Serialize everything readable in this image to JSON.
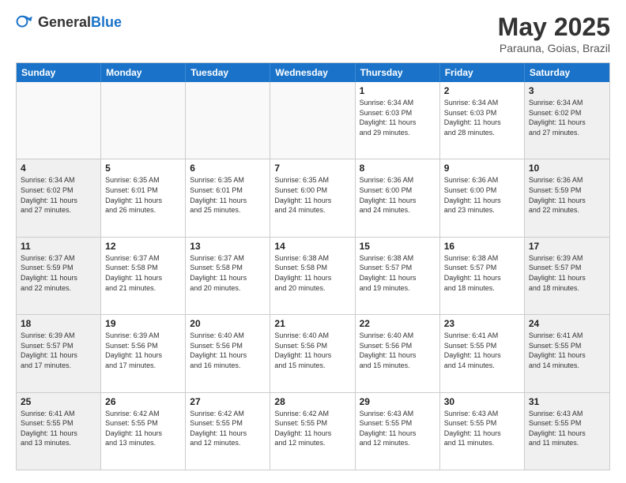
{
  "header": {
    "logo_general": "General",
    "logo_blue": "Blue",
    "month_year": "May 2025",
    "location": "Parauna, Goias, Brazil"
  },
  "day_headers": [
    "Sunday",
    "Monday",
    "Tuesday",
    "Wednesday",
    "Thursday",
    "Friday",
    "Saturday"
  ],
  "rows": [
    {
      "cells": [
        {
          "day": "",
          "info": "",
          "empty": true
        },
        {
          "day": "",
          "info": "",
          "empty": true
        },
        {
          "day": "",
          "info": "",
          "empty": true
        },
        {
          "day": "",
          "info": "",
          "empty": true
        },
        {
          "day": "1",
          "info": "Sunrise: 6:34 AM\nSunset: 6:03 PM\nDaylight: 11 hours\nand 29 minutes.",
          "empty": false
        },
        {
          "day": "2",
          "info": "Sunrise: 6:34 AM\nSunset: 6:03 PM\nDaylight: 11 hours\nand 28 minutes.",
          "empty": false
        },
        {
          "day": "3",
          "info": "Sunrise: 6:34 AM\nSunset: 6:02 PM\nDaylight: 11 hours\nand 27 minutes.",
          "empty": false
        }
      ]
    },
    {
      "cells": [
        {
          "day": "4",
          "info": "Sunrise: 6:34 AM\nSunset: 6:02 PM\nDaylight: 11 hours\nand 27 minutes.",
          "empty": false
        },
        {
          "day": "5",
          "info": "Sunrise: 6:35 AM\nSunset: 6:01 PM\nDaylight: 11 hours\nand 26 minutes.",
          "empty": false
        },
        {
          "day": "6",
          "info": "Sunrise: 6:35 AM\nSunset: 6:01 PM\nDaylight: 11 hours\nand 25 minutes.",
          "empty": false
        },
        {
          "day": "7",
          "info": "Sunrise: 6:35 AM\nSunset: 6:00 PM\nDaylight: 11 hours\nand 24 minutes.",
          "empty": false
        },
        {
          "day": "8",
          "info": "Sunrise: 6:36 AM\nSunset: 6:00 PM\nDaylight: 11 hours\nand 24 minutes.",
          "empty": false
        },
        {
          "day": "9",
          "info": "Sunrise: 6:36 AM\nSunset: 6:00 PM\nDaylight: 11 hours\nand 23 minutes.",
          "empty": false
        },
        {
          "day": "10",
          "info": "Sunrise: 6:36 AM\nSunset: 5:59 PM\nDaylight: 11 hours\nand 22 minutes.",
          "empty": false
        }
      ]
    },
    {
      "cells": [
        {
          "day": "11",
          "info": "Sunrise: 6:37 AM\nSunset: 5:59 PM\nDaylight: 11 hours\nand 22 minutes.",
          "empty": false
        },
        {
          "day": "12",
          "info": "Sunrise: 6:37 AM\nSunset: 5:58 PM\nDaylight: 11 hours\nand 21 minutes.",
          "empty": false
        },
        {
          "day": "13",
          "info": "Sunrise: 6:37 AM\nSunset: 5:58 PM\nDaylight: 11 hours\nand 20 minutes.",
          "empty": false
        },
        {
          "day": "14",
          "info": "Sunrise: 6:38 AM\nSunset: 5:58 PM\nDaylight: 11 hours\nand 20 minutes.",
          "empty": false
        },
        {
          "day": "15",
          "info": "Sunrise: 6:38 AM\nSunset: 5:57 PM\nDaylight: 11 hours\nand 19 minutes.",
          "empty": false
        },
        {
          "day": "16",
          "info": "Sunrise: 6:38 AM\nSunset: 5:57 PM\nDaylight: 11 hours\nand 18 minutes.",
          "empty": false
        },
        {
          "day": "17",
          "info": "Sunrise: 6:39 AM\nSunset: 5:57 PM\nDaylight: 11 hours\nand 18 minutes.",
          "empty": false
        }
      ]
    },
    {
      "cells": [
        {
          "day": "18",
          "info": "Sunrise: 6:39 AM\nSunset: 5:57 PM\nDaylight: 11 hours\nand 17 minutes.",
          "empty": false
        },
        {
          "day": "19",
          "info": "Sunrise: 6:39 AM\nSunset: 5:56 PM\nDaylight: 11 hours\nand 17 minutes.",
          "empty": false
        },
        {
          "day": "20",
          "info": "Sunrise: 6:40 AM\nSunset: 5:56 PM\nDaylight: 11 hours\nand 16 minutes.",
          "empty": false
        },
        {
          "day": "21",
          "info": "Sunrise: 6:40 AM\nSunset: 5:56 PM\nDaylight: 11 hours\nand 15 minutes.",
          "empty": false
        },
        {
          "day": "22",
          "info": "Sunrise: 6:40 AM\nSunset: 5:56 PM\nDaylight: 11 hours\nand 15 minutes.",
          "empty": false
        },
        {
          "day": "23",
          "info": "Sunrise: 6:41 AM\nSunset: 5:55 PM\nDaylight: 11 hours\nand 14 minutes.",
          "empty": false
        },
        {
          "day": "24",
          "info": "Sunrise: 6:41 AM\nSunset: 5:55 PM\nDaylight: 11 hours\nand 14 minutes.",
          "empty": false
        }
      ]
    },
    {
      "cells": [
        {
          "day": "25",
          "info": "Sunrise: 6:41 AM\nSunset: 5:55 PM\nDaylight: 11 hours\nand 13 minutes.",
          "empty": false
        },
        {
          "day": "26",
          "info": "Sunrise: 6:42 AM\nSunset: 5:55 PM\nDaylight: 11 hours\nand 13 minutes.",
          "empty": false
        },
        {
          "day": "27",
          "info": "Sunrise: 6:42 AM\nSunset: 5:55 PM\nDaylight: 11 hours\nand 12 minutes.",
          "empty": false
        },
        {
          "day": "28",
          "info": "Sunrise: 6:42 AM\nSunset: 5:55 PM\nDaylight: 11 hours\nand 12 minutes.",
          "empty": false
        },
        {
          "day": "29",
          "info": "Sunrise: 6:43 AM\nSunset: 5:55 PM\nDaylight: 11 hours\nand 12 minutes.",
          "empty": false
        },
        {
          "day": "30",
          "info": "Sunrise: 6:43 AM\nSunset: 5:55 PM\nDaylight: 11 hours\nand 11 minutes.",
          "empty": false
        },
        {
          "day": "31",
          "info": "Sunrise: 6:43 AM\nSunset: 5:55 PM\nDaylight: 11 hours\nand 11 minutes.",
          "empty": false
        }
      ]
    }
  ]
}
